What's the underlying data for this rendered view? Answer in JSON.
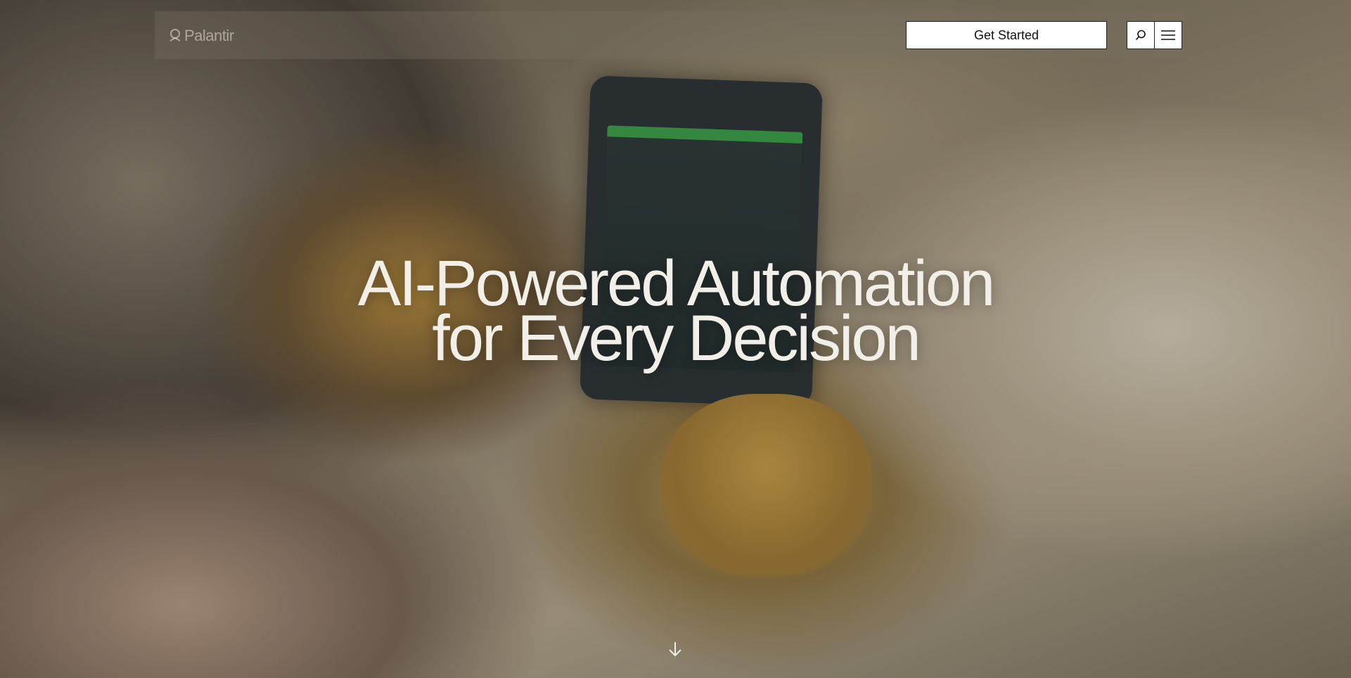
{
  "header": {
    "logo_text": "Palantir",
    "cta_label": "Get Started",
    "search_icon": "search-icon",
    "menu_icon": "menu-icon"
  },
  "hero": {
    "headline_line1": "AI-Powered Automation",
    "headline_line2": "for Every Decision",
    "scroll_icon": "arrow-down-icon"
  },
  "colors": {
    "headline": "#f2efe8",
    "button_bg": "#ffffff",
    "button_text": "#111111"
  }
}
